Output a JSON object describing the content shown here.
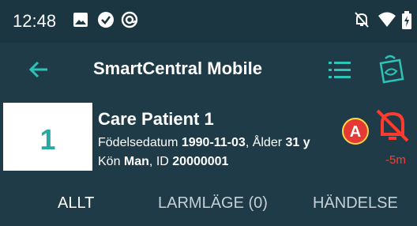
{
  "status_bar": {
    "time": "12:48",
    "left_icons": [
      "image-icon",
      "check-circle-icon",
      "at-circle-icon"
    ],
    "right_icons": [
      "bell-off-icon",
      "wifi-icon",
      "battery-icon"
    ]
  },
  "app_bar": {
    "title": "SmartCentral Mobile",
    "back_icon": "arrow-left-icon",
    "menu_icon": "list-icon",
    "right_icon": "bag-icon",
    "accent_color": "#2cc3b8"
  },
  "patient": {
    "bed_number": "1",
    "name": "Care Patient 1",
    "dob_label": "Födelsedatum",
    "dob": "1990-11-03",
    "age_label": ", Ålder",
    "age": "31 y",
    "sex_label": "Kön",
    "sex": "Man",
    "id_label": ", ID",
    "id": "20000001",
    "alarm_icon": "bell-off-icon",
    "alarm_time": "-5m",
    "callout_letter": "A",
    "alarm_color": "#ff3b2f",
    "callout_color": "#e53935"
  },
  "tabs": [
    {
      "label": "ALLT",
      "active": true
    },
    {
      "label": "LARMLÄGE (0)",
      "active": false
    },
    {
      "label": "HÄNDELSE",
      "active": false
    }
  ]
}
